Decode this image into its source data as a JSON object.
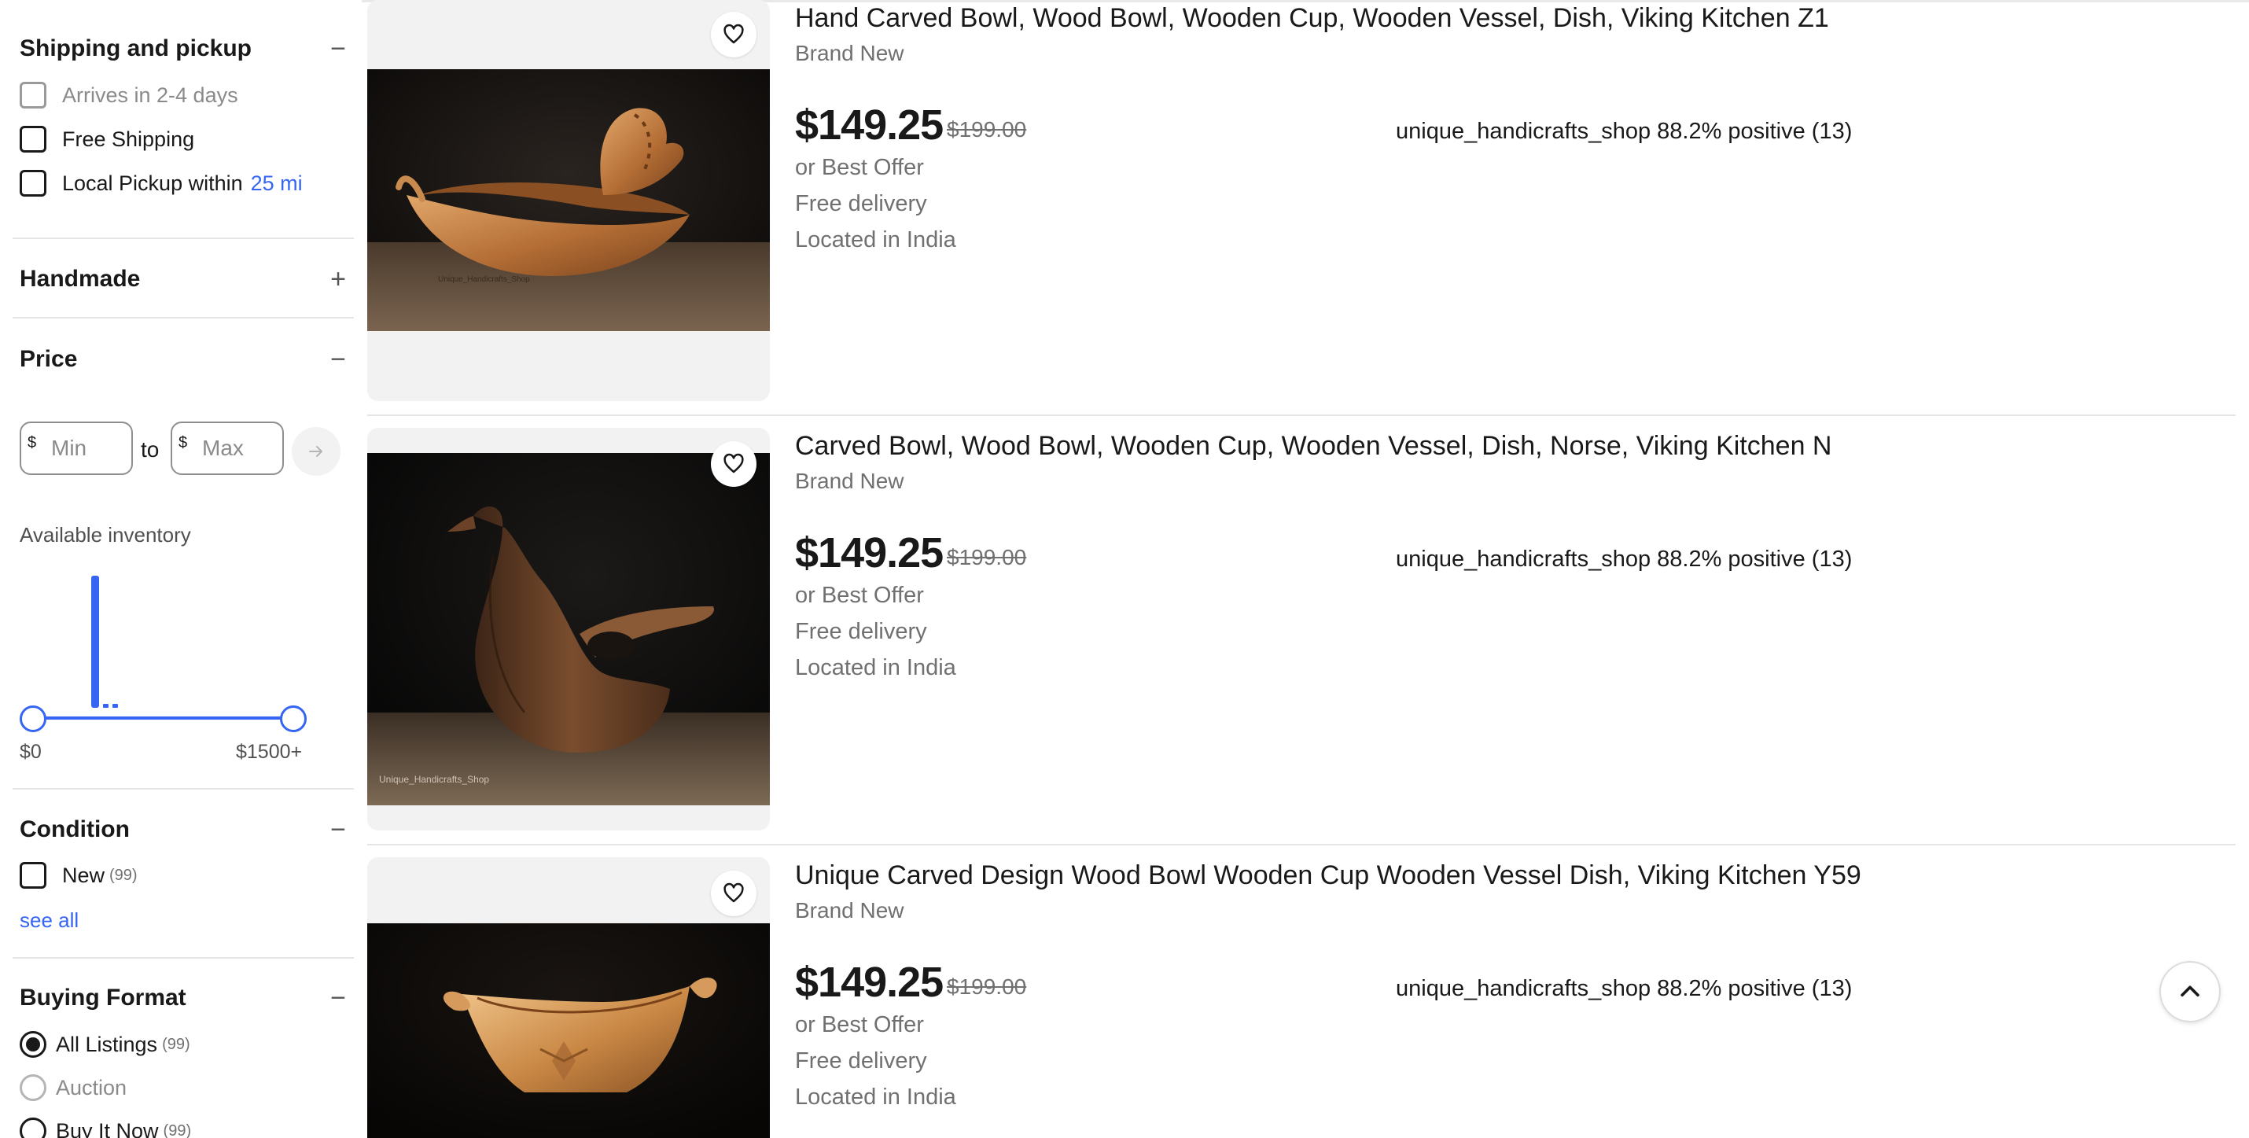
{
  "filters": {
    "shipping": {
      "title": "Shipping and pickup",
      "toggle": "−",
      "options": [
        {
          "label": "Arrives in 2-4 days",
          "checked": false,
          "disabled": true
        },
        {
          "label": "Free Shipping",
          "checked": false,
          "disabled": false
        },
        {
          "label": "Local Pickup within",
          "link": "25 mi",
          "checked": false,
          "disabled": false
        }
      ]
    },
    "handmade": {
      "title": "Handmade",
      "toggle": "+"
    },
    "price": {
      "title": "Price",
      "toggle": "−",
      "currency": "$",
      "min_placeholder": "Min",
      "max_placeholder": "Max",
      "to_label": "to",
      "inventory_label": "Available inventory",
      "range_min_label": "$0",
      "range_max_label": "$1500+"
    },
    "condition": {
      "title": "Condition",
      "toggle": "−",
      "options": [
        {
          "label": "New",
          "count": "(99)",
          "checked": false
        }
      ],
      "see_all": "see all"
    },
    "buying_format": {
      "title": "Buying Format",
      "toggle": "−",
      "options": [
        {
          "label": "All Listings",
          "count": "(99)",
          "selected": true
        },
        {
          "label": "Auction",
          "count": "",
          "selected": false,
          "disabled": true
        },
        {
          "label": "Buy It Now",
          "count": "(99)",
          "selected": false
        }
      ]
    }
  },
  "listings": [
    {
      "title": "Hand Carved Bowl, Wood Bowl, Wooden Cup, Wooden Vessel, Dish, Viking Kitchen Z1",
      "condition": "Brand New",
      "price": "$149.25",
      "original_price": "$199.00",
      "offer": "or Best Offer",
      "delivery": "Free delivery",
      "location": "Located in India",
      "seller": "unique_handicrafts_shop 88.2% positive (13)",
      "watermark": "Unique_Handicrafts_Shop"
    },
    {
      "title": "Carved Bowl, Wood Bowl, Wooden Cup, Wooden Vessel, Dish, Norse, Viking Kitchen N",
      "condition": "Brand New",
      "price": "$149.25",
      "original_price": "$199.00",
      "offer": "or Best Offer",
      "delivery": "Free delivery",
      "location": "Located in India",
      "seller": "unique_handicrafts_shop 88.2% positive (13)",
      "watermark": "Unique_Handicrafts_Shop"
    },
    {
      "title": "Unique Carved Design Wood Bowl Wooden Cup Wooden Vessel Dish, Viking Kitchen Y59",
      "condition": "Brand New",
      "price": "$149.25",
      "original_price": "$199.00",
      "offer": "or Best Offer",
      "delivery": "Free delivery",
      "location": "Located in India",
      "seller": "unique_handicrafts_shop 88.2% positive (13)"
    }
  ],
  "icons": {
    "heart": "heart-icon",
    "arrow": "arrow-right-icon",
    "scroll_top": "chevron-up-icon"
  },
  "colors": {
    "link_blue": "#3665f3",
    "slider_blue": "#3665f3",
    "text": "#191919",
    "muted": "#707070"
  }
}
